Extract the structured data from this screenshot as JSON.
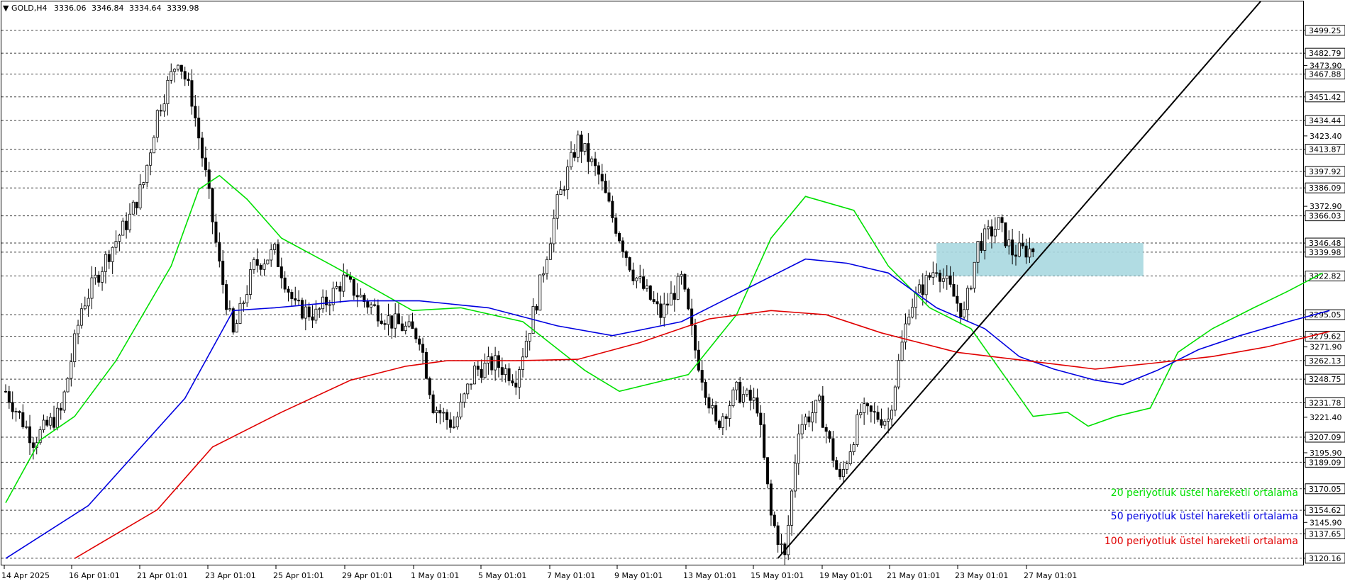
{
  "header": {
    "symbol": "GOLD,H4",
    "open": "3336.06",
    "high": "3346.84",
    "low": "3334.64",
    "close": "3339.98"
  },
  "colors": {
    "ema20": "#00e000",
    "ema50": "#0000e0",
    "ema100": "#e00000",
    "zone": "#a8d8e0",
    "bull": "#ffffff",
    "bear": "#000000"
  },
  "chart_data": {
    "type": "line",
    "title": "",
    "ylim": [
      3115,
      3520
    ],
    "grid": false,
    "legend_position": "bottom-right",
    "price_levels": [
      "3499.25",
      "3482.79",
      "3467.88",
      "3451.42",
      "3434.44",
      "3413.87",
      "3397.92",
      "3386.09",
      "3366.03",
      "3346.48",
      "3339.98",
      "3322.82",
      "3295.05",
      "3279.62",
      "3262.13",
      "3248.75",
      "3231.78",
      "3207.09",
      "3189.09",
      "3170.05",
      "3154.62",
      "3137.65",
      "3120.16"
    ],
    "axis_ticks": [
      "3473.90",
      "3423.40",
      "3372.90",
      "3271.90",
      "3221.40",
      "3195.90",
      "3145.90"
    ],
    "x_labels": [
      "14 Apr 2025",
      "16 Apr 01:01",
      "21 Apr 01:01",
      "23 Apr 01:01",
      "25 Apr 01:01",
      "29 Apr 01:01",
      "1 May 01:01",
      "5 May 01:01",
      "7 May 01:01",
      "9 May 01:01",
      "13 May 01:01",
      "15 May 01:01",
      "19 May 01:01",
      "21 May 01:01",
      "23 May 01:01",
      "27 May 01:01"
    ],
    "candles_bars": 200,
    "series": [
      {
        "name": "20 periyotluk üstel hareketli ortalama",
        "color": "#00e000",
        "points": [
          [
            0,
            3160
          ],
          [
            10,
            3205
          ],
          [
            20,
            3222
          ],
          [
            32,
            3262
          ],
          [
            48,
            3330
          ],
          [
            56,
            3385
          ],
          [
            62,
            3395
          ],
          [
            70,
            3378
          ],
          [
            80,
            3350
          ],
          [
            95,
            3330
          ],
          [
            108,
            3312
          ],
          [
            118,
            3298
          ],
          [
            132,
            3300
          ],
          [
            150,
            3290
          ],
          [
            168,
            3255
          ],
          [
            178,
            3240
          ],
          [
            198,
            3252
          ],
          [
            212,
            3295
          ],
          [
            222,
            3350
          ],
          [
            232,
            3380
          ],
          [
            246,
            3370
          ],
          [
            256,
            3330
          ],
          [
            268,
            3300
          ],
          [
            280,
            3285
          ],
          [
            290,
            3250
          ],
          [
            298,
            3222
          ],
          [
            308,
            3225
          ],
          [
            314,
            3215
          ],
          [
            322,
            3222
          ],
          [
            332,
            3228
          ],
          [
            340,
            3268
          ],
          [
            350,
            3285
          ],
          [
            362,
            3300
          ],
          [
            372,
            3312
          ],
          [
            382,
            3325
          ]
        ]
      },
      {
        "name": "50 periyotluk üstel hareketli ortalama",
        "color": "#0000e0",
        "points": [
          [
            0,
            3120
          ],
          [
            24,
            3158
          ],
          [
            52,
            3235
          ],
          [
            66,
            3298
          ],
          [
            78,
            3300
          ],
          [
            100,
            3305
          ],
          [
            120,
            3305
          ],
          [
            140,
            3300
          ],
          [
            160,
            3287
          ],
          [
            176,
            3280
          ],
          [
            196,
            3290
          ],
          [
            216,
            3315
          ],
          [
            232,
            3335
          ],
          [
            244,
            3332
          ],
          [
            256,
            3325
          ],
          [
            270,
            3300
          ],
          [
            284,
            3285
          ],
          [
            294,
            3265
          ],
          [
            304,
            3256
          ],
          [
            316,
            3248
          ],
          [
            324,
            3245
          ],
          [
            334,
            3255
          ],
          [
            346,
            3270
          ],
          [
            358,
            3280
          ],
          [
            372,
            3290
          ],
          [
            384,
            3298
          ]
        ]
      },
      {
        "name": "100 periyotluk üstel hareketli ortalama",
        "color": "#e00000",
        "points": [
          [
            20,
            3120
          ],
          [
            44,
            3155
          ],
          [
            60,
            3200
          ],
          [
            80,
            3225
          ],
          [
            100,
            3248
          ],
          [
            116,
            3258
          ],
          [
            128,
            3262
          ],
          [
            148,
            3262
          ],
          [
            166,
            3263
          ],
          [
            184,
            3275
          ],
          [
            204,
            3292
          ],
          [
            222,
            3298
          ],
          [
            238,
            3295
          ],
          [
            254,
            3282
          ],
          [
            276,
            3268
          ],
          [
            296,
            3262
          ],
          [
            316,
            3256
          ],
          [
            332,
            3260
          ],
          [
            350,
            3265
          ],
          [
            366,
            3272
          ],
          [
            384,
            3283
          ]
        ]
      }
    ]
  },
  "zone": {
    "label": "",
    "top": 3346.48,
    "bottom": 3322.82,
    "start_bar": 270,
    "end_bar": 330
  },
  "trendline": {
    "p1_bar": 224,
    "p1_price": 3120.16,
    "p2_bar": 364,
    "p2_price": 3520
  }
}
